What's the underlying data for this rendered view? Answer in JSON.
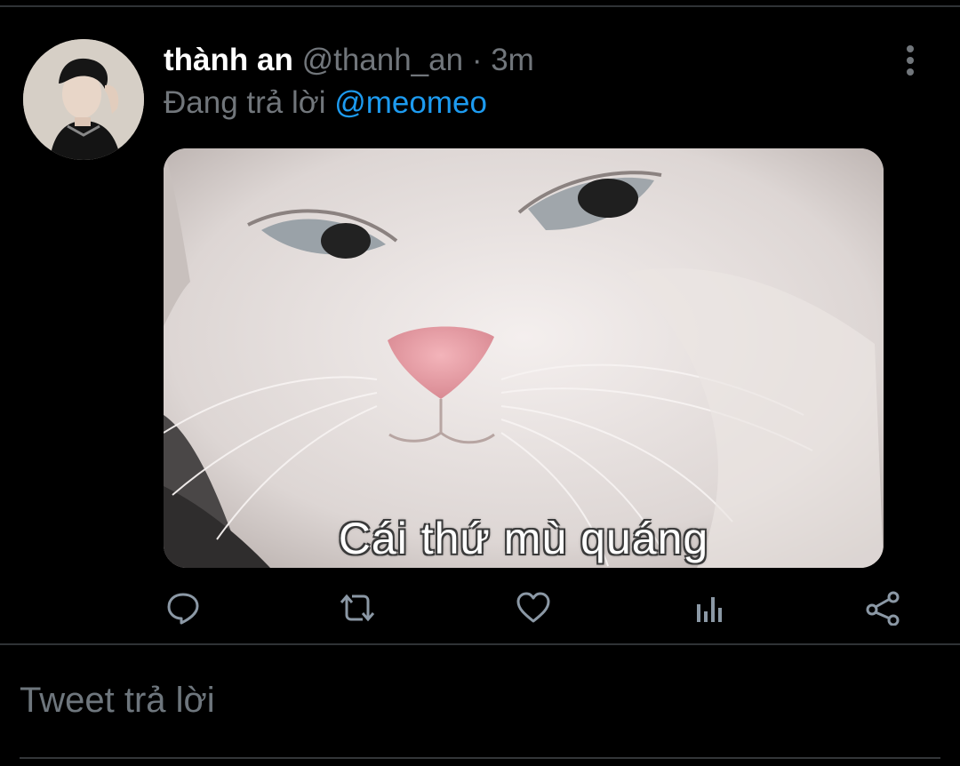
{
  "tweet": {
    "display_name": "thành an",
    "handle": "@thanh_an",
    "separator": "·",
    "time": "3m",
    "replying_prefix": "Đang trả lời",
    "replying_to": "@meomeo",
    "media": {
      "caption": "Cái thứ mù quáng"
    },
    "actions": [
      {
        "name": "reply",
        "icon": "reply-icon"
      },
      {
        "name": "retweet",
        "icon": "retweet-icon"
      },
      {
        "name": "like",
        "icon": "heart-icon"
      },
      {
        "name": "analytics",
        "icon": "analytics-icon"
      },
      {
        "name": "share",
        "icon": "share-icon"
      }
    ]
  },
  "composer": {
    "placeholder": "Tweet trả lời"
  },
  "colors": {
    "background": "#000000",
    "accent": "#1d9bf0",
    "secondary_text": "#71767b",
    "divider": "#2f3336"
  }
}
